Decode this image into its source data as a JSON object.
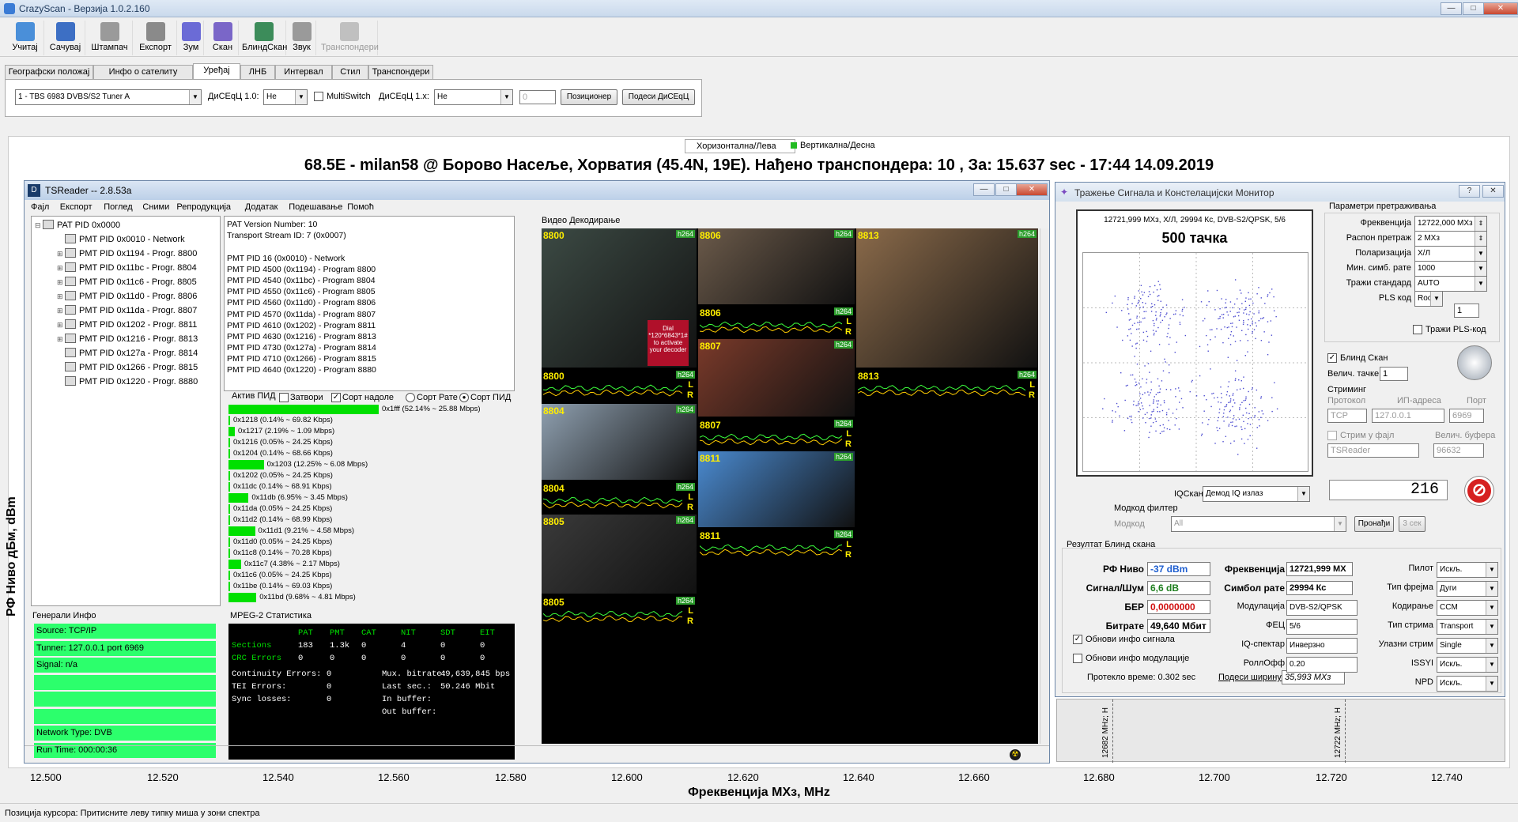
{
  "app": {
    "title": "CrazyScan - Верзија 1.0.2.160",
    "min": "—",
    "max": "□",
    "close": "✕"
  },
  "toolbar": [
    {
      "label": "Учитај",
      "icon": "open-icon",
      "color": "#4a8fd9"
    },
    {
      "label": "Сачувај",
      "icon": "save-icon",
      "color": "#3d6fc4"
    },
    {
      "label": "Штампач",
      "icon": "printer-icon",
      "color": "#9a9a9a"
    },
    {
      "label": "Експорт",
      "icon": "export-icon",
      "color": "#8a8a8a"
    },
    {
      "label": "Зум",
      "icon": "zoom-icon",
      "color": "#6b6bd6"
    },
    {
      "label": "Скан",
      "icon": "scan-icon",
      "color": "#7a66c8"
    },
    {
      "label": "БлиндСкан",
      "icon": "blindscan-icon",
      "color": "#3c8c5a"
    },
    {
      "label": "Звук",
      "icon": "sound-icon",
      "color": "#9a9a9a"
    },
    {
      "label": "Транспондери",
      "icon": "transponders-icon",
      "color": "#c0c0c0"
    }
  ],
  "tabs": [
    "Географски положај",
    "Инфо о сателиту",
    "Уређај",
    "ЛНБ",
    "Интервал",
    "Стил",
    "Транспондери"
  ],
  "device": {
    "tuner": "1 - TBS 6983 DVBS/S2 Tuner A",
    "diseqc10_label": "ДиСЕqЦ 1.0:",
    "diseqc10": "Не",
    "multiswitch": "MultiSwitch",
    "diseqc1x_label": "ДиСЕqЦ 1.x:",
    "diseqc1x": "Не",
    "spin": "0",
    "positioner": "Позиционер",
    "diseqc_settings": "Подеси ДиСЕqЦ"
  },
  "legend": {
    "h": "Хоризонтална/Лева",
    "v": "Вертикална/Десна",
    "v_color": "#22bb22"
  },
  "headline": "68.5E - milan58 @ Борово Насеље, Хорватия (45.4N, 19E). Нађено транспондера: 10 , За: 15.637 sec - 17:44 14.09.2019",
  "spectrum": {
    "ylabel": "РФ Ниво дБм, dBm",
    "xlabel": "Фреквенција  МХз, MHz",
    "xticks": [
      "12.500",
      "12.520",
      "12.540",
      "12.560",
      "12.580",
      "12.600",
      "12.620",
      "12.640",
      "12.660",
      "12.680",
      "12.700",
      "12.720",
      "12.740"
    ],
    "markers": [
      "12682 MHz; H",
      "12722 MHz; H"
    ]
  },
  "status": "Позиција курсора: Притисните леву типку миша у зони спектра",
  "tsreader": {
    "title": "TSReader -- 2.8.53a",
    "icon": "D",
    "menu": [
      "Фајл",
      "Експорт",
      "Поглед",
      "Сними",
      "Репродукција",
      "Додатак",
      "Подешавање",
      "Помоћ"
    ],
    "tree": [
      "PAT PID 0x0000",
      "PMT PID 0x0010 - Network",
      "PMT PID 0x1194 - Progr. 8800",
      "PMT PID 0x11bc - Progr. 8804",
      "PMT PID 0x11c6 - Progr. 8805",
      "PMT PID 0x11d0 - Progr. 8806",
      "PMT PID 0x11da - Progr. 8807",
      "PMT PID 0x1202 - Progr. 8811",
      "PMT PID 0x1216 - Progr. 8813",
      "PMT PID 0x127a - Progr. 8814",
      "PMT PID 0x1266 - Progr. 8815",
      "PMT PID 0x1220 - Progr. 8880"
    ],
    "info": [
      "PAT Version Number: 10",
      "Transport Stream ID: 7 (0x0007)",
      "",
      "PMT PID 16 (0x0010) - Network",
      "PMT PID 4500 (0x1194) - Program 8800",
      "PMT PID 4540 (0x11bc) - Program 8804",
      "PMT PID 4550 (0x11c6) - Program 8805",
      "PMT PID 4560 (0x11d0) - Program 8806",
      "PMT PID 4570 (0x11da) - Program 8807",
      "PMT PID 4610 (0x1202) - Program 8811",
      "PMT PID 4630 (0x1216) - Program 8813",
      "PMT PID 4730 (0x127a) - Program 8814",
      "PMT PID 4710 (0x1266) - Program 8815",
      "PMT PID 4640 (0x1220) - Program 8880"
    ],
    "active_pid": "Актив ПИД",
    "close_cb": "Затвори",
    "sort_top": "Сорт надоле",
    "sort_rate": "Сорт Рате",
    "sort_pid": "Сорт ПИД",
    "pids": [
      {
        "t": "0x1fff (52.14% ~ 25.88 Mbps)",
        "p": 52.14
      },
      {
        "t": "0x1218 (0.14% ~ 69.82 Kbps)",
        "p": 0.14
      },
      {
        "t": "0x1217 (2.19% ~ 1.09 Mbps)",
        "p": 2.19
      },
      {
        "t": "0x1216 (0.05% ~ 24.25 Kbps)",
        "p": 0.05
      },
      {
        "t": "0x1204 (0.14% ~ 68.66 Kbps)",
        "p": 0.14
      },
      {
        "t": "0x1203 (12.25% ~ 6.08 Mbps)",
        "p": 12.25
      },
      {
        "t": "0x1202 (0.05% ~ 24.25 Kbps)",
        "p": 0.05
      },
      {
        "t": "0x11dc (0.14% ~ 68.91 Kbps)",
        "p": 0.14
      },
      {
        "t": "0x11db (6.95% ~ 3.45 Mbps)",
        "p": 6.95
      },
      {
        "t": "0x11da (0.05% ~ 24.25 Kbps)",
        "p": 0.05
      },
      {
        "t": "0x11d2 (0.14% ~ 68.99 Kbps)",
        "p": 0.14
      },
      {
        "t": "0x11d1 (9.21% ~ 4.58 Mbps)",
        "p": 9.21
      },
      {
        "t": "0x11d0 (0.05% ~ 24.25 Kbps)",
        "p": 0.05
      },
      {
        "t": "0x11c8 (0.14% ~ 70.28 Kbps)",
        "p": 0.14
      },
      {
        "t": "0x11c7 (4.38% ~ 2.17 Mbps)",
        "p": 4.38
      },
      {
        "t": "0x11c6 (0.05% ~ 24.25 Kbps)",
        "p": 0.05
      },
      {
        "t": "0x11be (0.14% ~ 69.03 Kbps)",
        "p": 0.14
      },
      {
        "t": "0x11bd (9.68% ~ 4.81 Mbps)",
        "p": 9.68
      }
    ],
    "general_title": "Генерали Инфо",
    "general": [
      "Source: TCP/IP",
      "Tunner: 127.0.0.1 port 6969",
      "Signal: n/a",
      "",
      "",
      "",
      "Network Type: DVB",
      "Run Time: 000:00:36"
    ],
    "mpeg_title": "MPEG-2 Статистика",
    "mpeg_head": [
      "PAT",
      "PMT",
      "CAT",
      "NIT",
      "SDT",
      "EIT"
    ],
    "sections": [
      "Sections",
      "183",
      "1.3k",
      "0",
      "4",
      "0",
      "0"
    ],
    "crc": [
      "CRC Errors",
      "0",
      "0",
      "0",
      "0",
      "0",
      "0"
    ],
    "cont": [
      "Continuity Errors:",
      "0"
    ],
    "tei": [
      "TEI Errors:",
      "0"
    ],
    "sync": [
      "Sync losses:",
      "0"
    ],
    "mux": [
      "Mux. bitrate:",
      "49,639,845 bps"
    ],
    "last": [
      "Last sec.:",
      "50.246 Mbit"
    ],
    "inbuf": "In buffer:",
    "outbuf": "Out buffer:",
    "video_title": "Видео Декодирање",
    "videos": [
      {
        "n": "8800",
        "c": "#3c4a44"
      },
      {
        "n": "8806",
        "c": "#6b5a4a"
      },
      {
        "n": "8813",
        "c": "#8a6a4a"
      },
      {
        "n": "8807",
        "c": "#7a3a2a"
      },
      {
        "n": "8804",
        "c": "#8fa0b0"
      },
      {
        "n": "8811",
        "c": "#4a8ad0"
      },
      {
        "n": "8805",
        "c": "#3a3a3a"
      }
    ],
    "audio": [
      "8806",
      "8800",
      "8813",
      "8807",
      "8804",
      "8811",
      "8805"
    ],
    "dial": "Dial *120*6843*1# to activate your decoder",
    "h264": "h264",
    "L": "L",
    "R": "R"
  },
  "monitor": {
    "title": "Тражење Сигнала и Констелацијски Монитор",
    "help": "?",
    "close": "✕",
    "info": "12721,999 МХз, Х/Л, 29994 Кс, DVB-S2/QPSK, 5/6",
    "points": "500 тачка",
    "params_title": "Параметри претраживања",
    "params": [
      {
        "l": "Фреквенција",
        "v": "12722,000 МХз"
      },
      {
        "l": "Распон претраж",
        "v": "2 МХз"
      },
      {
        "l": "Поларизација",
        "v": "Х/Л"
      },
      {
        "l": "Мин. симб. рате",
        "v": "1000"
      },
      {
        "l": "Тражи стандард",
        "v": "AUTO"
      },
      {
        "l": "PLS код",
        "v": "Root"
      }
    ],
    "pls_num": "1",
    "pls_search": "Тражи PLS-код",
    "blind": "Блинд Скан",
    "step_label": "Велич. тачке",
    "step": "1",
    "stream_title": "Стриминг",
    "protocol_l": "Протокол",
    "ip_l": "ИП-адреса",
    "port_l": "Порт",
    "protocol": "TCP",
    "ip": "127.0.0.1",
    "port": "6969",
    "file_stream": "Стрим у фајл",
    "buf_l": "Велич. буфера",
    "reader": "TSReader",
    "buf": "96632",
    "counter": "216",
    "iq_l": "IQСкан тачка",
    "iq": "Демод IQ излаз",
    "modcod_title": "Модкод филтер",
    "modcod_l": "Модкод",
    "modcod": "All",
    "find": "Пронађи",
    "sec": "3 сек",
    "result_title": "Резултат Блинд скана",
    "rf_l": "РФ Ниво",
    "rf": "-37 dBm",
    "snr_l": "Сигнал/Шум",
    "snr": "6,6 dB",
    "ber_l": "БЕР",
    "ber": "0,0000000",
    "bit_l": "Битрате",
    "bit": "49,640 Мбит",
    "freq_l": "Фреквенција",
    "freq": "12721,999 МХ",
    "sr_l": "Симбол рате",
    "sr": "29994 Кс",
    "mod_l": "Модулација",
    "mod": "DVB-S2/QPSK",
    "fec_l": "ФЕЦ",
    "fec": "5/6",
    "iqs_l": "IQ-спектар",
    "iqs": "Инверзно",
    "roll_l": "РоллОфф",
    "roll": "0.20",
    "pilot_l": "Пилот",
    "pilot": "Искљ.",
    "frame_l": "Тип фрејма",
    "frame": "Дуги",
    "code_l": "Кодирање",
    "code": "CCM",
    "st_l": "Тип стрима",
    "st": "Transport",
    "is_l": "Улазни стрим",
    "is": "Single",
    "issy_l": "ISSYI",
    "issy": "Искљ.",
    "npd_l": "NPD",
    "npd": "Искљ.",
    "upd_sig": "Обнови инфо сигнала",
    "upd_mod": "Обнови инфо модулације",
    "elapsed": "Протекло време: 0.302 sec",
    "bw_l": "Подеси ширину",
    "bw": "35,993 МХз"
  }
}
